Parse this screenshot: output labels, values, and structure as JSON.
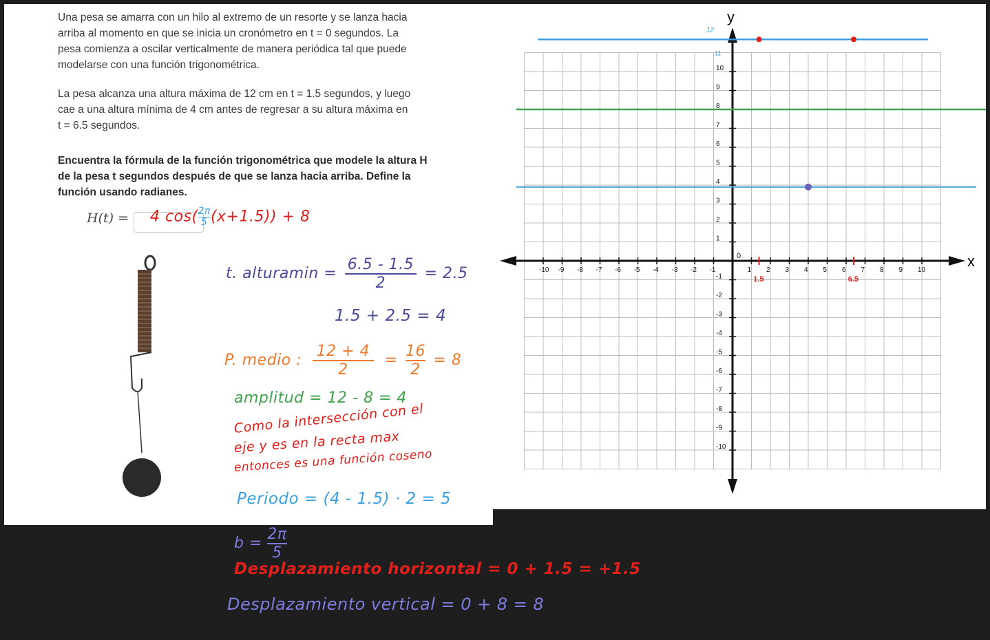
{
  "problem": {
    "p1": "Una pesa se amarra con un hilo al extremo de un resorte y se lanza hacia arriba al momento en que se inicia un cronómetro en t = 0 segundos. La pesa comienza a oscilar verticalmente de manera periódica tal que puede modelarse con una función trigonométrica.",
    "p1_lines": [
      "Una pesa se amarra con un hilo al extremo de un resorte y se lanza hacia",
      "arriba al momento en que se inicia un cronómetro en t = 0 segundos. La",
      "pesa comienza a oscilar verticalmente de manera periódica tal que puede",
      "modelarse con una función trigonométrica."
    ],
    "p2_lines": [
      "La pesa alcanza una altura máxima de 12 cm en t = 1.5 segundos, y luego",
      "cae a una altura mínima de 4 cm antes de regresar a su altura máxima en",
      "t = 6.5 segundos."
    ],
    "p3_lines": [
      "Encuentra la fórmula de la función trigonométrica que modele la altura H",
      "de la pesa t segundos después de que se lanza hacia arriba. Define la",
      "función usando radianes."
    ],
    "formula_label": "H(t) ="
  },
  "handwriting": {
    "answer": "4 cos(2π/5 (x+1.5)) + 8",
    "answer_parts": {
      "a": "4 cos(",
      "num": "2π",
      "den": "5",
      "b": "(x+1.5)) + 8"
    },
    "t_min": "t. alturamin =",
    "t_min_num": "6.5 - 1.5",
    "t_min_den": "2",
    "t_min_result": "= 2.5",
    "t_min_sum": "1.5 + 2.5 = 4",
    "p_medio": "P. medio :",
    "p_medio_num": "12 + 4",
    "p_medio_den": "2",
    "p_medio_eq": "=",
    "p_medio_num2": "16",
    "p_medio_den2": "2",
    "p_medio_result": "= 8",
    "amplitud": "amplitud = 12 - 8 = 4",
    "coseno_1": "Como la intersección con el",
    "coseno_2": "eje y es en la recta max",
    "coseno_3": "entonces es una función coseno",
    "periodo": "Periodo = (4 - 1.5) · 2 = 5",
    "b_label": "b =",
    "b_num": "2π",
    "b_den": "5",
    "desp_h": "Desplazamiento horizontal = 0 + 1.5 = +1.5",
    "desp_v": "Desplazamiento vertical = 0 + 8 = 8"
  },
  "graph": {
    "axis_x_label": "x",
    "axis_y_label": "y",
    "origin_label": "0",
    "x_ticks": [
      "-10",
      "-9",
      "-8",
      "-7",
      "-6",
      "-5",
      "-4",
      "-3",
      "-2",
      "-1",
      "1",
      "2",
      "3",
      "4",
      "5",
      "6",
      "7",
      "8",
      "9",
      "10"
    ],
    "y_ticks": [
      "10",
      "9",
      "8",
      "7",
      "6",
      "5",
      "4",
      "3",
      "2",
      "1",
      "-1",
      "-2",
      "-3",
      "-4",
      "-5",
      "-6",
      "-7",
      "-8",
      "-9",
      "-10"
    ],
    "annot_12": "12",
    "annot_11": "11",
    "annot_1_5": "1.5",
    "annot_6_5": "6.5",
    "colors": {
      "blue": "#3aa0e0",
      "green": "#3fa14b",
      "red": "#e0201a",
      "point": "#6a63b5"
    }
  }
}
